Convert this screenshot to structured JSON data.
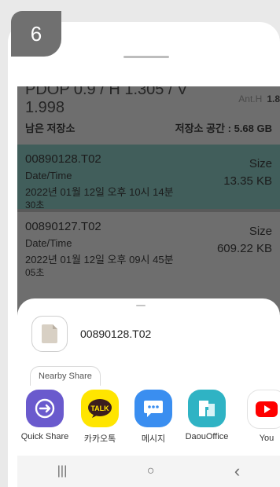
{
  "step_number": "6",
  "background_panel": {
    "pdop_text": "PDOP 0.9 / H 1.305 / V 1.998",
    "ant_label": "Ant.H",
    "ant_value": "1.8",
    "storage_label": "남은 저장소",
    "storage_value": "저장소 공간 : 5.68 GB",
    "files": [
      {
        "name": "00890128.T02",
        "datetime_label": "Date/Time",
        "datetime_value": "2022년 01월 12일 오후 10시 14분",
        "datetime_more": "30초",
        "size_label": "Size",
        "size_value": "13.35 KB",
        "selected": true
      },
      {
        "name": "00890127.T02",
        "datetime_label": "Date/Time",
        "datetime_value": "2022년 01월 12일 오후 09시 45분",
        "datetime_more": "05초",
        "size_label": "Size",
        "size_value": "609.22 KB",
        "selected": false
      }
    ]
  },
  "share_sheet": {
    "file_name": "00890128.T02",
    "nearby_share_label": "Nearby Share",
    "apps": [
      {
        "label": "Quick Share",
        "icon": "quick-share-icon",
        "color": "#6a5acd"
      },
      {
        "label": "카카오톡",
        "icon": "kakaotalk-icon",
        "color": "#ffe500"
      },
      {
        "label": "메시지",
        "icon": "messages-icon",
        "color": "#3a8ef0"
      },
      {
        "label": "DaouOffice",
        "icon": "daouoffice-icon",
        "color": "#2fb3c4"
      },
      {
        "label": "You",
        "icon": "youtube-icon",
        "color": "#ff0000"
      }
    ]
  },
  "nav": {
    "recent_icon": "|||",
    "home_icon": "○",
    "back_icon": "‹"
  },
  "colors": {
    "selected_row": "#415e5b",
    "dim_overlay": "#6e6e6e"
  }
}
